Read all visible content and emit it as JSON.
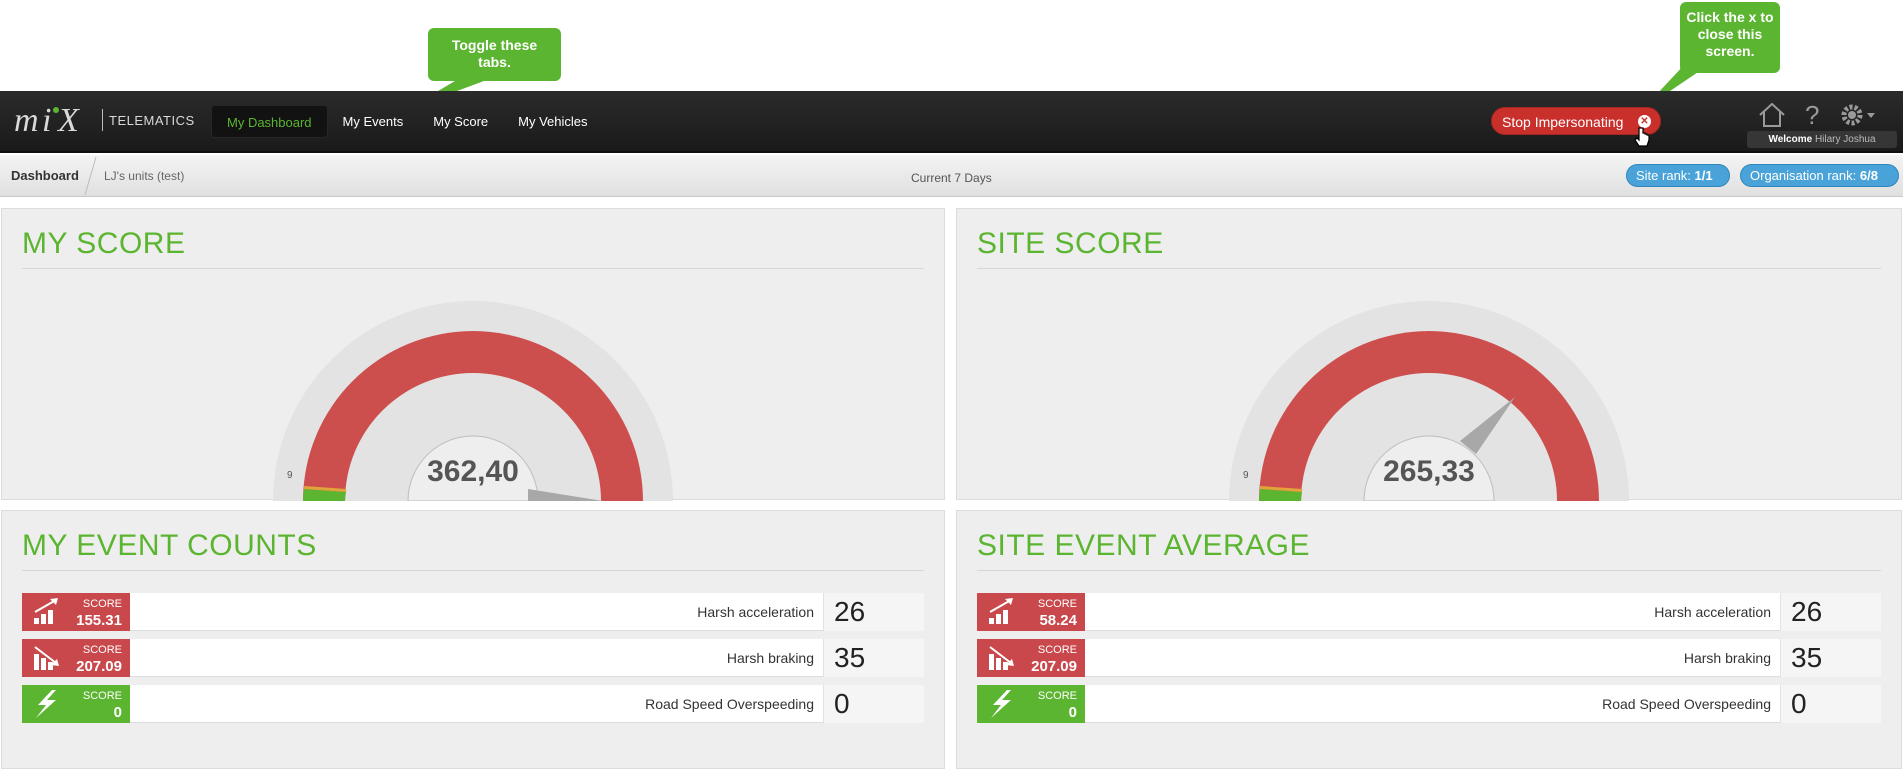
{
  "tooltips": {
    "tabs": "Toggle these tabs.",
    "close": "Click the x to close this screen."
  },
  "brand": {
    "logo_text": "mix",
    "product": "TELEMATICS"
  },
  "nav": {
    "items": [
      {
        "label": "My Dashboard",
        "active": true
      },
      {
        "label": "My Events",
        "active": false
      },
      {
        "label": "My Score",
        "active": false
      },
      {
        "label": "My Vehicles",
        "active": false
      }
    ]
  },
  "stop_button": {
    "label": "Stop Impersonating"
  },
  "user": {
    "welcome_label": "Welcome",
    "name": "Hilary Joshua"
  },
  "icons": [
    "home-icon",
    "help-icon",
    "gear-icon"
  ],
  "breadcrumb": {
    "home": "Dashboard",
    "sub": "LJ's units (test)"
  },
  "period": "Current 7 Days",
  "ranks": {
    "site_label": "Site rank:",
    "site_value": "1/1",
    "org_label": "Organisation rank:",
    "org_value": "6/8"
  },
  "colors": {
    "green": "#5cb531",
    "red": "#c9484b",
    "blue": "#4aa3d8",
    "topbar": "#222222"
  },
  "my_score": {
    "title": "MY SCORE",
    "value_text": "362,40",
    "min_label": "9",
    "value": 362.4
  },
  "site_score": {
    "title": "SITE SCORE",
    "value_text": "265,33",
    "min_label": "9",
    "value": 265.33
  },
  "my_events": {
    "title": "MY EVENT COUNTS",
    "rows": [
      {
        "score_label": "SCORE",
        "score": "155.31",
        "name": "Harsh acceleration",
        "count": "26",
        "status": "red",
        "icon": "acceleration-icon"
      },
      {
        "score_label": "SCORE",
        "score": "207.09",
        "name": "Harsh braking",
        "count": "35",
        "status": "red",
        "icon": "braking-icon"
      },
      {
        "score_label": "SCORE",
        "score": "0",
        "name": "Road Speed Overspeeding",
        "count": "0",
        "status": "green",
        "icon": "lightning-icon"
      }
    ]
  },
  "site_events": {
    "title": "SITE EVENT AVERAGE",
    "rows": [
      {
        "score_label": "SCORE",
        "score": "58.24",
        "name": "Harsh acceleration",
        "count": "26",
        "status": "red",
        "icon": "acceleration-icon"
      },
      {
        "score_label": "SCORE",
        "score": "207.09",
        "name": "Harsh braking",
        "count": "35",
        "status": "red",
        "icon": "braking-icon"
      },
      {
        "score_label": "SCORE",
        "score": "0",
        "name": "Road Speed Overspeeding",
        "count": "0",
        "status": "green",
        "icon": "lightning-icon"
      }
    ]
  }
}
